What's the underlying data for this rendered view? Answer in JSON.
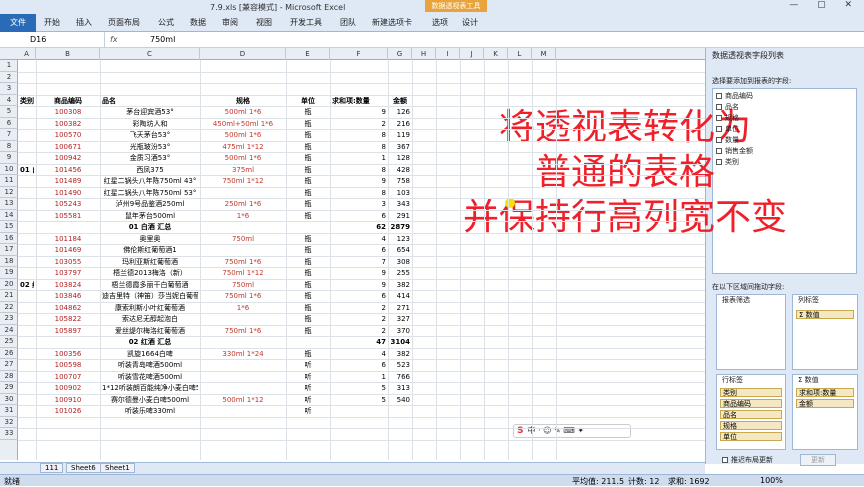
{
  "window": {
    "title": "7.9.xls [兼容模式] - Microsoft Excel",
    "context_tab": "数据透视表工具"
  },
  "ribbon": {
    "file": "文件",
    "tabs": [
      "开始",
      "插入",
      "页面布局",
      "公式",
      "数据",
      "审阅",
      "视图",
      "开发工具",
      "团队",
      "新建选项卡",
      "选项",
      "设计"
    ]
  },
  "formula": {
    "namebox": "D16",
    "fx": "fx",
    "value": "750ml"
  },
  "columns": [
    "A",
    "B",
    "C",
    "D",
    "E",
    "F",
    "G",
    "H",
    "I",
    "J",
    "K",
    "L",
    "M"
  ],
  "rows": [
    "1",
    "2",
    "3",
    "4",
    "5",
    "6",
    "7",
    "8",
    "9",
    "10",
    "11",
    "12",
    "13",
    "14",
    "15",
    "16",
    "17",
    "18",
    "19",
    "20",
    "21",
    "22",
    "23",
    "24",
    "25",
    "26",
    "27",
    "28",
    "29",
    "30",
    "31",
    "32",
    "33"
  ],
  "table": {
    "headers": {
      "type": "类别",
      "code": "商品编码",
      "name": "品名",
      "spec": "规格",
      "unit": "单位",
      "qty": "求和项:数量",
      "amt": "金额"
    },
    "group1": {
      "label": "01 白酒",
      "subtotal_label": "01 白酒 汇总",
      "subtotal_qty": "62",
      "subtotal_amt": "2879",
      "items": [
        {
          "code": "100308",
          "name": "茅台迎宾酒53°",
          "spec": "500ml 1*6",
          "unit": "瓶",
          "qty": "9",
          "amt": "126"
        },
        {
          "code": "100382",
          "name": "彩陶坊人和",
          "spec": "450ml+50ml 1*6",
          "unit": "瓶",
          "qty": "2",
          "amt": "216"
        },
        {
          "code": "100570",
          "name": "飞天茅台53°",
          "spec": "500ml 1*6",
          "unit": "瓶",
          "qty": "8",
          "amt": "119"
        },
        {
          "code": "100671",
          "name": "光瓶玻汾53°",
          "spec": "475ml 1*12",
          "unit": "瓶",
          "qty": "8",
          "amt": "367"
        },
        {
          "code": "100942",
          "name": "金质习酒53°",
          "spec": "500ml 1*6",
          "unit": "瓶",
          "qty": "1",
          "amt": "128"
        },
        {
          "code": "101456",
          "name": "西凤375",
          "spec": "375ml",
          "unit": "瓶",
          "qty": "8",
          "amt": "428"
        },
        {
          "code": "101489",
          "name": "红星二锅头八年陈750ml 43°",
          "spec": "",
          "unit": "瓶",
          "qty": "9",
          "amt": "758"
        },
        {
          "code": "101490",
          "name": "红星二锅头八年陈750ml 53°",
          "spec": "",
          "unit": "瓶",
          "qty": "8",
          "amt": "103"
        },
        {
          "code": "105243",
          "name": "泸州9号品鉴酒250ml",
          "spec": "250ml 1*6",
          "unit": "瓶",
          "qty": "3",
          "amt": "343"
        },
        {
          "code": "105581",
          "name": "鼠年茅台500ml",
          "spec": "1*6",
          "unit": "瓶",
          "qty": "6",
          "amt": "291"
        }
      ],
      "merged_spec": "750ml 1*12"
    },
    "group2": {
      "label": "02 红酒",
      "subtotal_label": "02 红酒 汇总",
      "subtotal_qty": "47",
      "subtotal_amt": "3104",
      "items": [
        {
          "code": "101184",
          "name": "奥里奥",
          "spec": "",
          "unit": "瓶",
          "qty": "4",
          "amt": "123"
        },
        {
          "code": "101469",
          "name": "佛伦斯红葡萄酒1",
          "spec": "",
          "unit": "瓶",
          "qty": "6",
          "amt": "654"
        },
        {
          "code": "103055",
          "name": "玛利亚斯红葡萄酒",
          "spec": "750ml 1*6",
          "unit": "瓶",
          "qty": "7",
          "amt": "308"
        },
        {
          "code": "103797",
          "name": "梧兰德2013梅洛（新）",
          "spec": "750ml 1*12",
          "unit": "瓶",
          "qty": "9",
          "amt": "255"
        },
        {
          "code": "103824",
          "name": "梧兰德霞多丽干白葡萄酒",
          "spec": "750ml",
          "unit": "瓶",
          "qty": "9",
          "amt": "382"
        },
        {
          "code": "103846",
          "name": "迪吉里特（神笛）莎当妮白葡萄酒",
          "spec": "750ml 1*6",
          "unit": "瓶",
          "qty": "6",
          "amt": "414"
        },
        {
          "code": "104862",
          "name": "康索利斯小叶红葡萄酒",
          "spec": "",
          "unit": "瓶",
          "qty": "2",
          "amt": "271"
        },
        {
          "code": "105822",
          "name": "索达尼无醇起泡白",
          "spec": "",
          "unit": "瓶",
          "qty": "2",
          "amt": "327"
        },
        {
          "code": "105897",
          "name": "爱丝缇尔梅洛红葡萄酒",
          "spec": "750ml 1*6",
          "unit": "瓶",
          "qty": "2",
          "amt": "370"
        }
      ],
      "top_spec": "750ml",
      "mid_spec": "1*6"
    },
    "group3": {
      "label": "03 啤酒",
      "items": [
        {
          "code": "100356",
          "name": "凯旋1664白啤",
          "spec": "330ml 1*24",
          "unit": "瓶",
          "qty": "4",
          "amt": "382"
        },
        {
          "code": "100598",
          "name": "听装青岛啤酒500ml",
          "spec": "",
          "unit": "听",
          "qty": "6",
          "amt": "523"
        },
        {
          "code": "100707",
          "name": "听装雪花啤酒500ml",
          "spec": "",
          "unit": "听",
          "qty": "1",
          "amt": "766"
        },
        {
          "code": "100902",
          "name": "1*12听装朗百能纯净小麦白啤500ml",
          "spec": "",
          "unit": "听",
          "qty": "5",
          "amt": "313"
        },
        {
          "code": "100910",
          "name": "赛尔德曼小麦白啤500ml",
          "spec": "",
          "unit": "听",
          "qty": "5",
          "amt": "540"
        },
        {
          "code": "101026",
          "name": "听装乐啤330ml",
          "spec": "",
          "unit": "听",
          "qty": "",
          "amt": ""
        }
      ],
      "merged_spec": "500ml 1*12"
    }
  },
  "pivot": {
    "title": "数据透视表字段列表",
    "prompt": "选择要添加到报表的字段:",
    "fields": [
      "商品编码",
      "品名",
      "规格",
      "单位",
      "数量",
      "销售金额",
      "类别"
    ],
    "drag_label": "在以下区域间拖动字段:",
    "filter": "报表筛选",
    "col": "列标签",
    "col_item": "Σ 数值",
    "row": "行标签",
    "values": "Σ 数值",
    "row_items": [
      "类别",
      "商品编码",
      "品名",
      "规格",
      "单位"
    ],
    "value_items": [
      "求和项:数量",
      "金额"
    ],
    "defer": "推迟布局更新",
    "update": "更新"
  },
  "overlay": {
    "line1": "将透视表转化为",
    "line2": "普通的表格",
    "line3": "并保持行高列宽不变"
  },
  "sheets": [
    "111",
    "Sheet6",
    "Sheet1"
  ],
  "status": {
    "ready": "就绪",
    "avg": "平均值: 211.5",
    "count": "计数: 12",
    "sum": "求和: 1692",
    "zoom": "100%"
  }
}
